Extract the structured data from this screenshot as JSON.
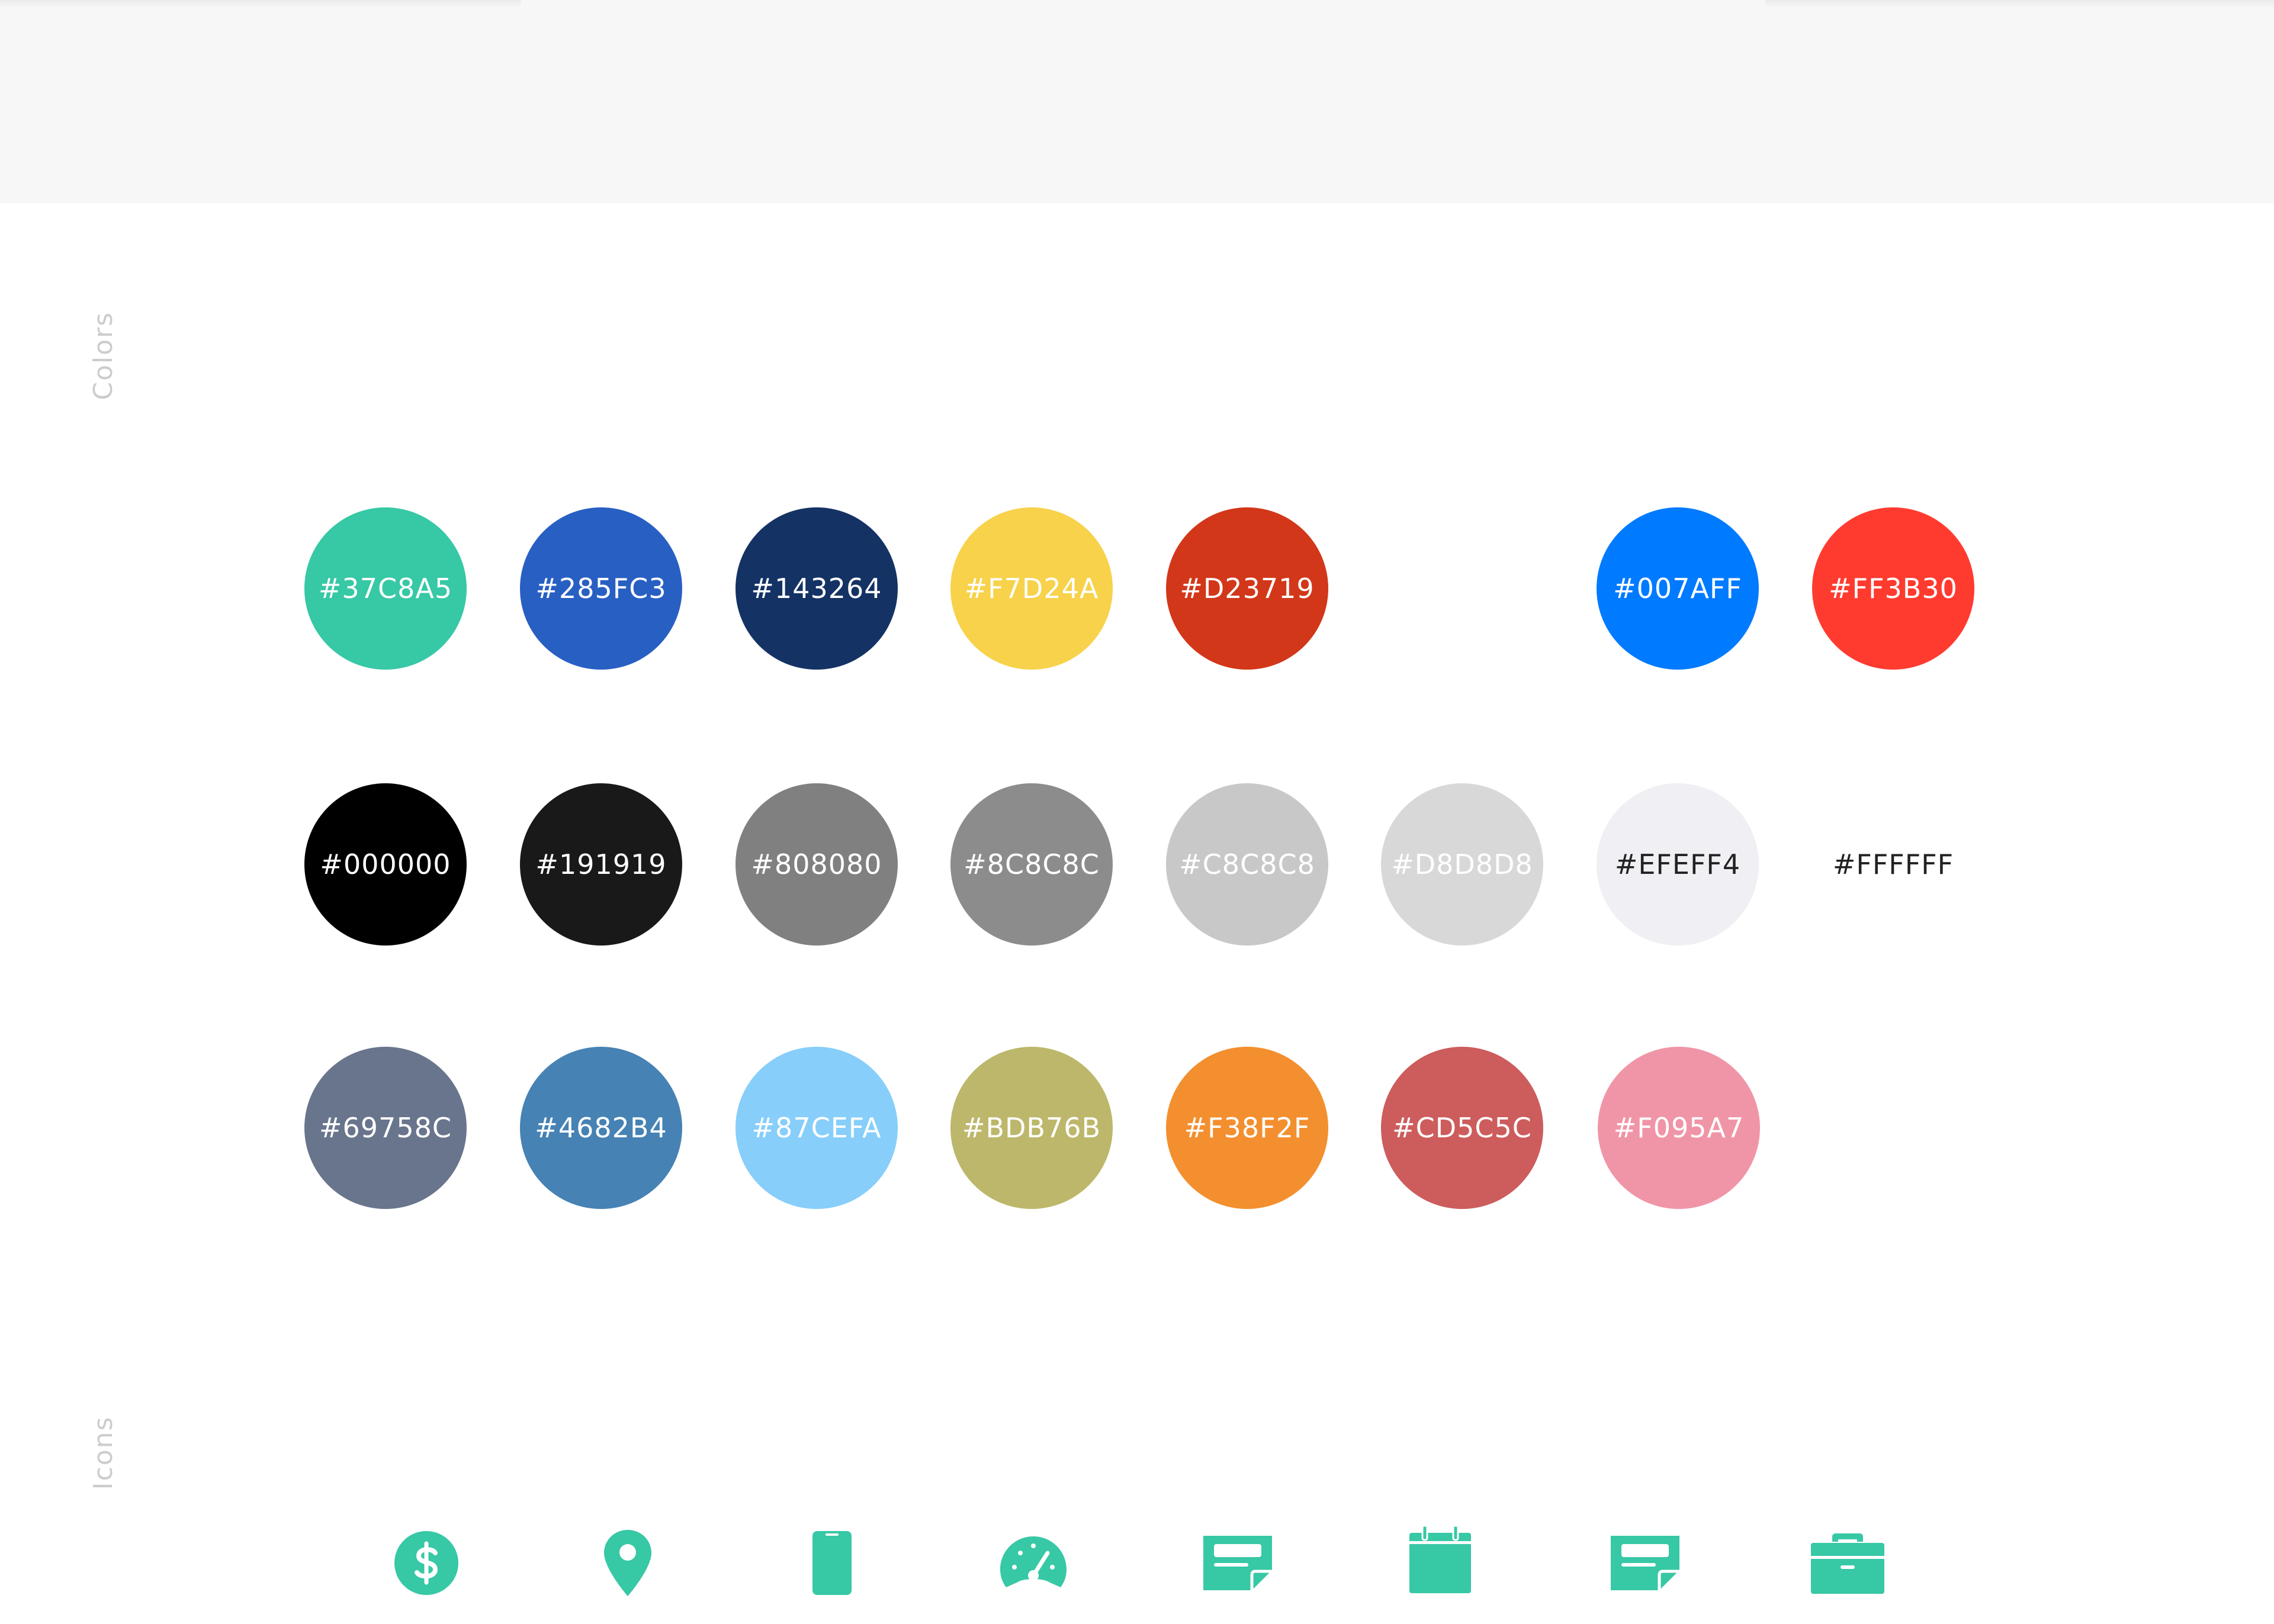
{
  "sections": {
    "colors_label": "Colors",
    "icons_label": "Icons"
  },
  "palette": {
    "row1": [
      {
        "hex": "#37C8A5",
        "fill": "#37C8A5",
        "text_color": "#ffffff"
      },
      {
        "hex": "#285FC3",
        "fill": "#285FC3",
        "text_color": "#ffffff"
      },
      {
        "hex": "#143264",
        "fill": "#143264",
        "text_color": "#ffffff"
      },
      {
        "hex": "#F7D24A",
        "fill": "#F7D24A",
        "text_color": "#ffffff"
      },
      {
        "hex": "#D23719",
        "fill": "#D23719",
        "text_color": "#ffffff"
      },
      {
        "hex": "#007AFF",
        "fill": "#007AFF",
        "text_color": "#ffffff"
      },
      {
        "hex": "#FF3B30",
        "fill": "#FF3B30",
        "text_color": "#ffffff"
      }
    ],
    "row2": [
      {
        "hex": "#000000",
        "fill": "#000000",
        "text_color": "#ffffff"
      },
      {
        "hex": "#191919",
        "fill": "#191919",
        "text_color": "#ffffff"
      },
      {
        "hex": "#808080",
        "fill": "#808080",
        "text_color": "#ffffff"
      },
      {
        "hex": "#8C8C8C",
        "fill": "#8C8C8C",
        "text_color": "#ffffff"
      },
      {
        "hex": "#C8C8C8",
        "fill": "#C8C8C8",
        "text_color": "#ffffff"
      },
      {
        "hex": "#D8D8D8",
        "fill": "#D8D8D8",
        "text_color": "#ffffff"
      },
      {
        "hex": "#EFEFF4",
        "fill": "#EFEFF4",
        "text_color": "#222222"
      },
      {
        "hex": "#FFFFFF",
        "fill": "#FFFFFF",
        "text_color": "#222222"
      }
    ],
    "row3": [
      {
        "hex": "#69758C",
        "fill": "#69758C",
        "text_color": "#ffffff"
      },
      {
        "hex": "#4682B4",
        "fill": "#4682B4",
        "text_color": "#ffffff"
      },
      {
        "hex": "#87CEFA",
        "fill": "#87CEFA",
        "text_color": "#ffffff"
      },
      {
        "hex": "#BDB76B",
        "fill": "#BDB76B",
        "text_color": "#ffffff"
      },
      {
        "hex": "#F38F2F",
        "fill": "#F38F2F",
        "text_color": "#ffffff"
      },
      {
        "hex": "#CD5C5C",
        "fill": "#CD5C5C",
        "text_color": "#ffffff"
      },
      {
        "hex": "#F095A7",
        "fill": "#F095A7",
        "text_color": "#ffffff"
      }
    ]
  },
  "icons": {
    "color": "#37C8A5",
    "items": [
      {
        "name": "dollar-icon"
      },
      {
        "name": "location-pin-icon"
      },
      {
        "name": "mobile-phone-icon"
      },
      {
        "name": "speedometer-icon"
      },
      {
        "name": "note-card-icon"
      },
      {
        "name": "calendar-icon"
      },
      {
        "name": "note-card-icon"
      },
      {
        "name": "briefcase-icon"
      }
    ]
  }
}
